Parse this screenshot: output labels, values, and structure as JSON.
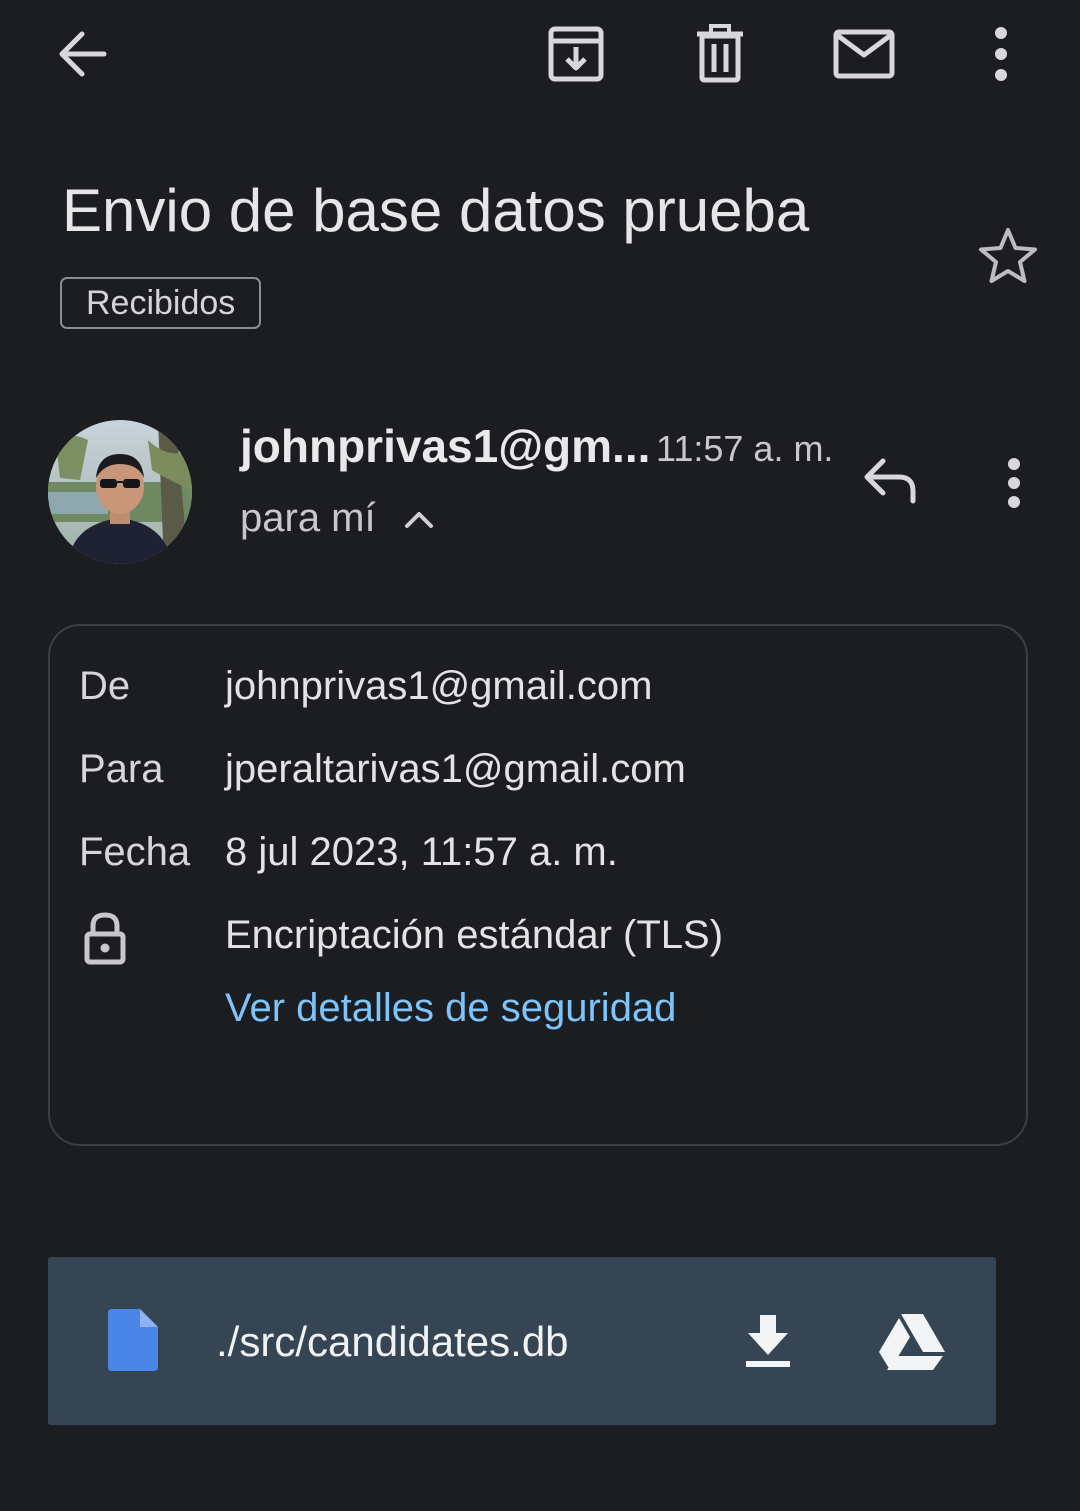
{
  "toolbar": {
    "back_icon": "arrow-left-icon",
    "archive_icon": "archive-icon",
    "delete_icon": "trash-icon",
    "mark_unread_icon": "mail-icon",
    "more_icon": "more-vert-icon"
  },
  "email": {
    "subject": "Envio de base datos prueba",
    "label": "Recibidos",
    "starred": false
  },
  "message": {
    "sender_display": "johnprivas1@gm...",
    "time": "11:57 a. m.",
    "recipient_summary": "para mí",
    "reply_icon": "reply-icon"
  },
  "details": {
    "from_label": "De",
    "from_value": "johnprivas1@gmail.com",
    "to_label": "Para",
    "to_value": "jperaltarivas1@gmail.com",
    "date_label": "Fecha",
    "date_value": "8 jul 2023, 11:57 a. m.",
    "encryption": "Encriptación estándar (TLS)",
    "security_link": "Ver detalles de seguridad"
  },
  "attachment": {
    "name": "./src/candidates.db",
    "file_icon": "file-icon",
    "download_icon": "download-icon",
    "drive_icon": "google-drive-icon"
  },
  "colors": {
    "background": "#1b1d21",
    "link": "#7cc4fa",
    "attachment_bg": "#354554",
    "file_icon": "#4a86e8"
  }
}
